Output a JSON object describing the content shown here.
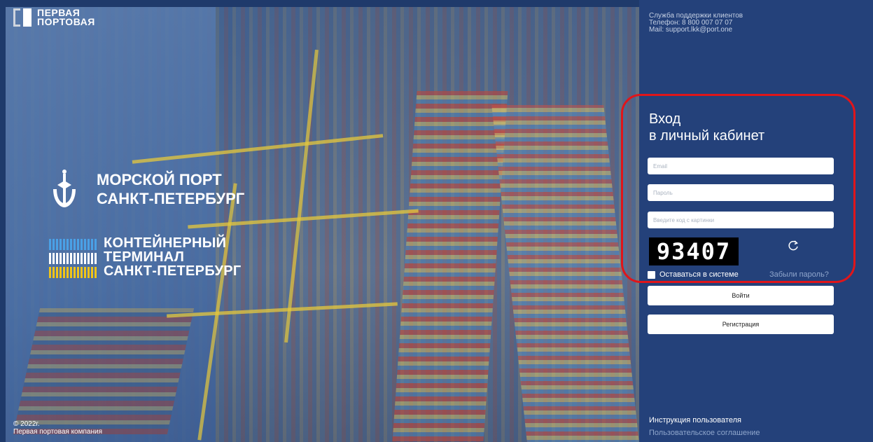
{
  "brand": {
    "line1": "ПЕРВАЯ",
    "line2": "ПОРТОВАЯ"
  },
  "port_logo": {
    "line1": "МОРСКОЙ ПОРТ",
    "line2": "САНКТ-ПЕТЕРБУРГ",
    "icon": "trident-anchor-icon"
  },
  "terminal_logo": {
    "line1": "КОНТЕЙНЕРНЫЙ",
    "line2": "ТЕРМИНАЛ",
    "line3": "САНКТ-ПЕТЕРБУРГ"
  },
  "footer_left": {
    "year": "© 2022г.",
    "company": "Первая портовая компания"
  },
  "support": {
    "title": "Служба поддержки клиентов",
    "phone": "Телефон: 8 800 007 07 07",
    "mail": "Mail: support.lkk@port.one"
  },
  "login": {
    "title_line1": "Вход",
    "title_line2": "в личный кабинет",
    "email_placeholder": "Email",
    "password_placeholder": "Пароль",
    "captcha_placeholder": "Введите код с картинки",
    "captcha_code": "93407",
    "remember_label": "Оставаться в системе",
    "forgot_label": "Забыли пароль?",
    "login_button": "Войти",
    "register_button": "Регистрация"
  },
  "footer_right": {
    "instructions": "Инструкция пользователя",
    "agreement": "Пользовательское соглашение"
  },
  "colors": {
    "panel": "#24417a",
    "highlight": "#e0151a"
  }
}
